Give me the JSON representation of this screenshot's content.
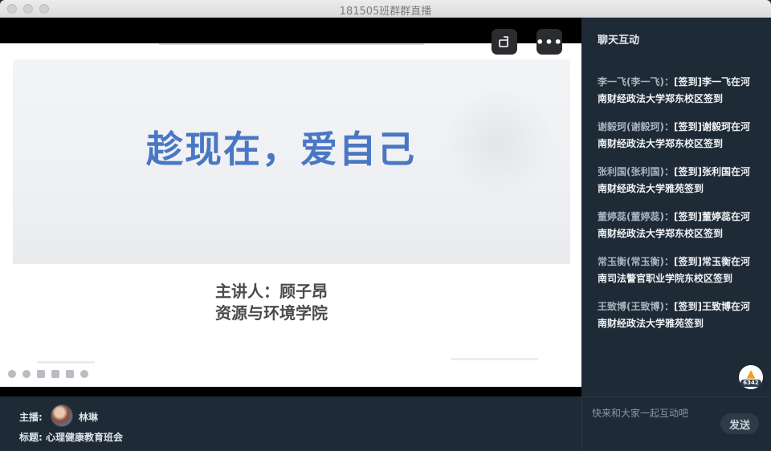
{
  "window": {
    "title": "181505班群群直播"
  },
  "video": {
    "slide_title": "趁现在，爱自己",
    "presenter_line1": "主讲人：顾子昂",
    "presenter_line2": "资源与环境学院",
    "rotate_icon": "rotate-screen-icon",
    "more_icon": "more-dots-icon",
    "more_label": "•••"
  },
  "info": {
    "host_label": "主播:",
    "host_name": "林琳",
    "subject_label": "标题:",
    "subject_value": "心理健康教育班会"
  },
  "chat": {
    "header": "聊天互动",
    "messages": [
      {
        "sender": "李一飞(李一飞)：",
        "text": "[签到]李一飞在河南财经政法大学郑东校区签到"
      },
      {
        "sender": "谢毅珂(谢毅珂)：",
        "text": "[签到]谢毅珂在河南财经政法大学郑东校区签到"
      },
      {
        "sender": "张利国(张利国)：",
        "text": "[签到]张利国在河南财经政法大学雅苑签到"
      },
      {
        "sender": "董婷蕊(董婷蕊)：",
        "text": "[签到]董婷蕊在河南财经政法大学郑东校区签到"
      },
      {
        "sender": "常玉衡(常玉衡)：",
        "text": "[签到]常玉衡在河南司法警官职业学院东校区签到"
      },
      {
        "sender": "王致博(王致博)：",
        "text": "[签到]王致博在河南财经政法大学雅苑签到"
      }
    ],
    "like_count": "6342",
    "input_placeholder": "快来和大家一起互动吧",
    "send_label": "发送"
  }
}
